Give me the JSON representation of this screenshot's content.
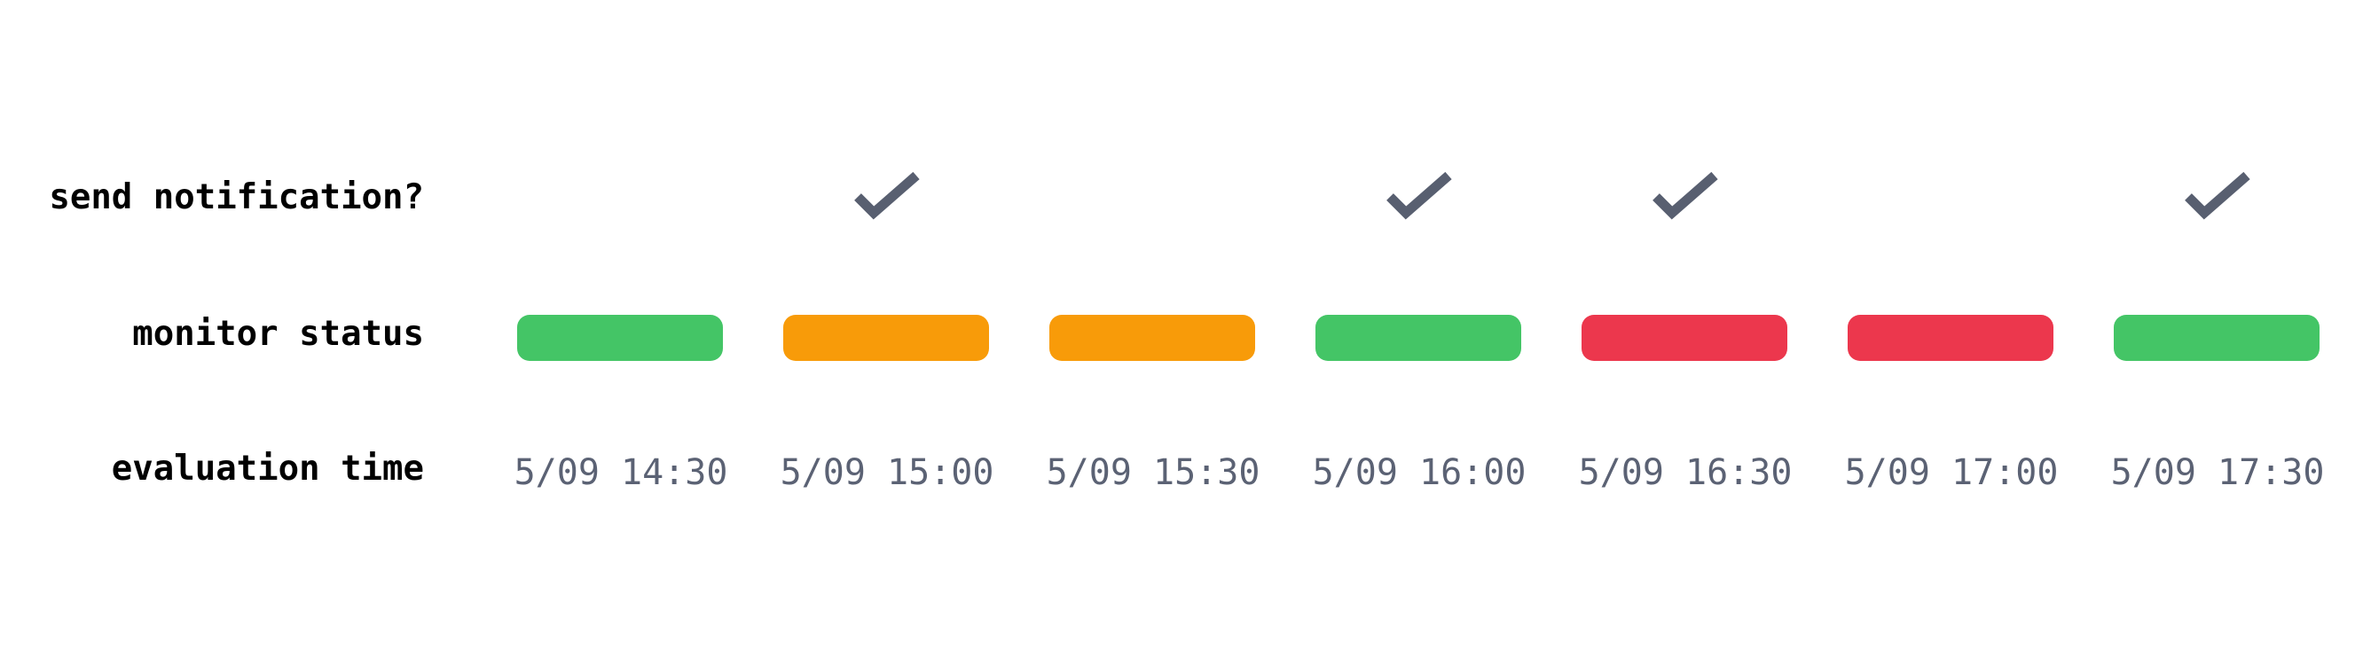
{
  "labels": {
    "notify": "send notification?",
    "status": "monitor status",
    "eval": "evaluation time"
  },
  "colors": {
    "ok": "#44c566",
    "warn": "#f89b09",
    "alert": "#ec374d",
    "check": "#585f70",
    "time_text": "#5b6274"
  },
  "evaluations": [
    {
      "time": "5/09 14:30",
      "status": "ok",
      "notify": false
    },
    {
      "time": "5/09 15:00",
      "status": "warn",
      "notify": true
    },
    {
      "time": "5/09 15:30",
      "status": "warn",
      "notify": false
    },
    {
      "time": "5/09 16:00",
      "status": "ok",
      "notify": true
    },
    {
      "time": "5/09 16:30",
      "status": "alert",
      "notify": true
    },
    {
      "time": "5/09 17:00",
      "status": "alert",
      "notify": false
    },
    {
      "time": "5/09 17:30",
      "status": "ok",
      "notify": true
    }
  ]
}
